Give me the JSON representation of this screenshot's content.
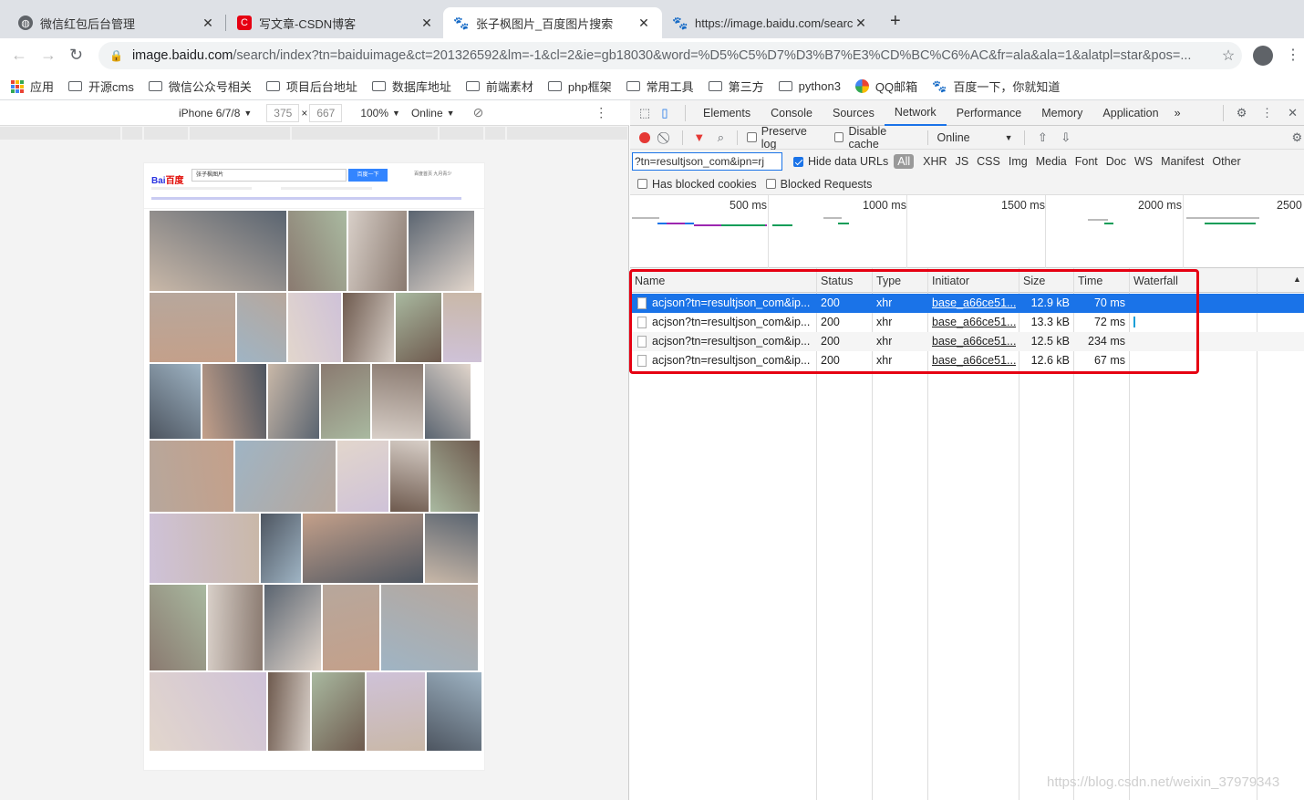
{
  "tabs": [
    {
      "title": "微信红包后台管理",
      "favicon": "globe-icon",
      "fav_color": "#5f6368"
    },
    {
      "title": "写文章-CSDN博客",
      "favicon": "csdn-icon",
      "fav_color": "#e60012",
      "fav_glyph": "C"
    },
    {
      "title": "张子枫图片_百度图片搜索",
      "favicon": "baidu-paw-icon",
      "fav_color": "#2932e1"
    },
    {
      "title": "https://image.baidu.com/searc",
      "favicon": "baidu-paw-icon",
      "fav_color": "#2932e1"
    }
  ],
  "close_glyph": "✕",
  "new_tab_glyph": "+",
  "address": {
    "host": "image.baidu.com",
    "path": "/search/index?tn=baiduimage&ct=201326592&lm=-1&cl=2&ie=gb18030&word=%D5%C5%D7%D3%B7%E3%CD%BC%C6%AC&fr=ala&ala=1&alatpl=star&pos=..."
  },
  "bookmarks": [
    "应用",
    "开源cms",
    "微信公众号相关",
    "项目后台地址",
    "数据库地址",
    "前端素材",
    "php框架",
    "常用工具",
    "第三方",
    "python3",
    "QQ邮箱",
    "百度一下，你就知道"
  ],
  "emulator": {
    "device": "iPhone 6/7/8",
    "width": "375",
    "height": "667",
    "zoom": "100%",
    "network": "Online"
  },
  "baidu": {
    "logo_a": "Bai",
    "logo_b": "百度",
    "query": "张子枫图片",
    "button": "百度一下",
    "top_links": "百度首页   九月青少"
  },
  "devtools": {
    "tabs": [
      "Elements",
      "Console",
      "Sources",
      "Network",
      "Performance",
      "Memory",
      "Application"
    ],
    "selected_tab": "Network",
    "more": "»",
    "preserve_log": "Preserve log",
    "disable_cache": "Disable cache",
    "throttle": "Online",
    "filter_value": "?tn=resultjson_com&ipn=rj",
    "hide_data_urls": "Hide data URLs",
    "types": [
      "All",
      "XHR",
      "JS",
      "CSS",
      "Img",
      "Media",
      "Font",
      "Doc",
      "WS",
      "Manifest",
      "Other"
    ],
    "has_blocked_cookies": "Has blocked cookies",
    "blocked_requests": "Blocked Requests",
    "timeline_labels": [
      "500 ms",
      "1000 ms",
      "1500 ms",
      "2000 ms",
      "2500"
    ],
    "columns": [
      "Name",
      "Status",
      "Type",
      "Initiator",
      "Size",
      "Time",
      "Waterfall"
    ],
    "requests": [
      {
        "name": "acjson?tn=resultjson_com&ip...",
        "status": "200",
        "type": "xhr",
        "initiator": "base_a66ce51...",
        "size": "12.9 kB",
        "time": "70 ms"
      },
      {
        "name": "acjson?tn=resultjson_com&ip...",
        "status": "200",
        "type": "xhr",
        "initiator": "base_a66ce51...",
        "size": "13.3 kB",
        "time": "72 ms"
      },
      {
        "name": "acjson?tn=resultjson_com&ip...",
        "status": "200",
        "type": "xhr",
        "initiator": "base_a66ce51...",
        "size": "12.5 kB",
        "time": "234 ms"
      },
      {
        "name": "acjson?tn=resultjson_com&ip...",
        "status": "200",
        "type": "xhr",
        "initiator": "base_a66ce51...",
        "size": "12.6 kB",
        "time": "67 ms"
      }
    ]
  },
  "watermark": "https://blog.csdn.net/weixin_37979343"
}
